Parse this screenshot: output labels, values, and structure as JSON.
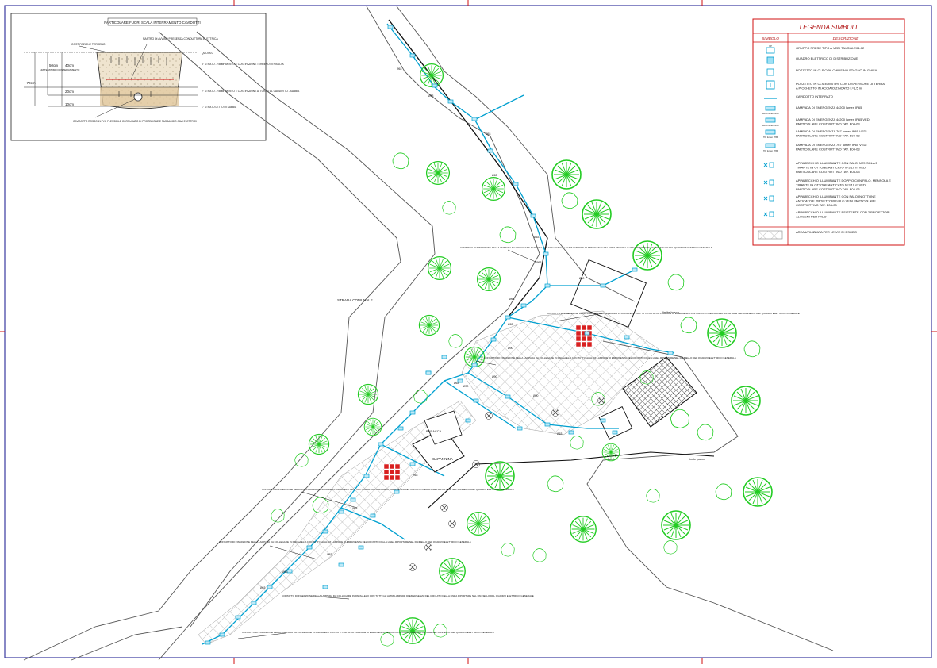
{
  "detail": {
    "title": "PARTICOLARE FUORI SCALA INTERRAMENTO CAVIDOTTI",
    "labels": {
      "ground": "COSTIPAZIONE TERRENO",
      "warning_tape": "NASTRO DI AVVISO PRESENZA CONDUTTURA ELETTRICA",
      "quota": "QUOTA 0",
      "layer3": "3° STRATO - RIEMPIMENTO E COSTIPAZIONE TERRENO DI RISULTA",
      "layer2": "2° STRATO - RIEMPIMENTO E COSTIPAZIONE ATTORNO AL CAVIDOTTO - SABBIA",
      "layer1": "1° STRATO LETTO DI SABBIA",
      "conduit": "CAVIDOTTO ROSSO IN PVC FLESSIBILE CORRUGATO DI PROTEZIONE E PASSAGGIO CAVI ELETTRICI",
      "depth_note": "LIMITE MINIMO DI INTERRAMENTO"
    },
    "dims": {
      "d50": "50cm",
      "d40": "40cm",
      "d20": "20cm",
      "d10": "10cm",
      "d70": "~70cm"
    }
  },
  "legend": {
    "title": "LEGENDA SIMBOLI",
    "col_symbol": "SIMBOLO",
    "col_desc": "DESCRIZIONE",
    "items": [
      {
        "symbol_text": "GP",
        "desc": "GRUPPO PRESE TIPO A VEDI TAVOLA E04-02"
      },
      {
        "symbol_text": "",
        "desc": "QUADRO ELETTRICO DI DISTRIBUZIONE"
      },
      {
        "symbol_text": "",
        "desc": "POZZETTO IN CLS CON CHIUSINO STAGNO IN GHISA"
      },
      {
        "symbol_text": "",
        "desc": "POZZETTO IN CLS 40x40 cm, CON DISPERSORE DI TERRA A PICCHETTO IN ACCIAIO ZINCATO L=1,5 m"
      },
      {
        "symbol_text": "",
        "desc": "CAVIDOTTO INTERRATO"
      },
      {
        "symbol_text": "4x200 lumen IP65",
        "desc": "LAMPADA DI EMERGENZA 4x200 lumen IP65"
      },
      {
        "symbol_text": "4x200 lumen IP65",
        "desc": "LAMPADA DI EMERGENZA 4x200 lumen IP65 VEDI PARTICOLARE COSTRUTTIVO TAV. E04-03"
      },
      {
        "symbol_text": "767 lumen IP65",
        "desc": "LAMPADA DI EMERGENZA 767 lumen IP65 VEDI PARTICOLARE COSTRUTTIVO TAV. E04-03"
      },
      {
        "symbol_text": "767 lumen IP65",
        "desc": "LAMPADA DI EMERGENZA 767 lumen IP65 VEDI PARTICOLARE COSTRUTTIVO TAV. E04-03"
      },
      {
        "symbol_text": "",
        "desc": "APPARECCHIO ILLUMINANTE CON PALO, MENSOLA E TIRANTE IN OTTONE ANTICATO h=3,10 m VEDI PARTICOLARE COSTRUTTIVO TAV. E04-03"
      },
      {
        "symbol_text": "",
        "desc": "APPARECCHIO ILLUMINANTE DOPPIO CON PALO, MENSOLA E TIRANTE IN OTTONE ANTICATO h=3,10 m VEDI PARTICOLARE COSTRUTTIVO TAV. E04-03"
      },
      {
        "symbol_text": "",
        "desc": "APPARECCHIO ILLUMINANTE CON PALO IN OTTONE ANTICATO E PROIETTORI h=8 m VEDI PARTICOLARE COSTRUTTIVO TAV. E04-03"
      },
      {
        "symbol_text": "",
        "desc": "APPARECCHIO ILLUMINANTE ESISTENTE CON 2 PROIETTORI ALOGENI PER PALO"
      },
      {
        "symbol_text": "",
        "desc": "AREA UTILIZZATA PER LE VIE DI ESODO"
      }
    ]
  },
  "map": {
    "strada": "STRADA COMUNALE",
    "capanna": "CAPANNINA",
    "baracca": "BARACCA",
    "area_boschiva": "limite bosco",
    "limite_parco": "limite parco",
    "conduit_label": "Ø63",
    "conduit_label_b": "Ø90",
    "note_text": "CONTATTO DI INSERZIONE DELLA LAMPADA DA COLLEGARE IN PARALLELO CON TUTTI GLI ALTRI LAMPADE DI EMERGENZA DEL CIRCUITO DELLA LINEA RIPORTARE NEL PANNELLO DEL QUADRO ELETTRICO GENERALE"
  },
  "colors": {
    "tree": "#22cc22",
    "conduit": "#00a0d0",
    "frame": "#3a3aa0",
    "legend_border": "#d01010",
    "hatch": "#b0b0b0"
  }
}
